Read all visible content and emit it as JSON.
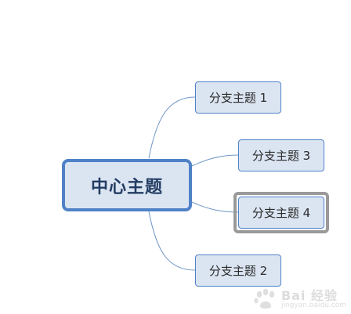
{
  "mindmap": {
    "central_topic": "中心主题",
    "branches": [
      {
        "id": "b1",
        "label": "分支主题 1"
      },
      {
        "id": "b3",
        "label": "分支主题 3"
      },
      {
        "id": "b4",
        "label": "分支主题 4",
        "selected": true
      },
      {
        "id": "b2",
        "label": "分支主题 2"
      }
    ]
  },
  "watermark": {
    "title": "Bai 经验",
    "url": "jingyan.baidu.com"
  },
  "colors": {
    "node_fill": "#dbe5f2",
    "node_border": "#4f81c7",
    "connector": "#6f95c6",
    "selection": "#9a9a9a"
  }
}
